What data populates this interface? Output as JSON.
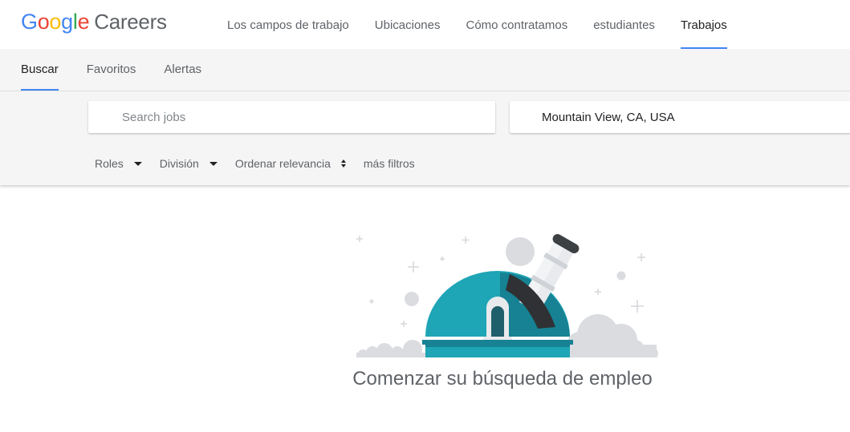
{
  "header": {
    "logo": {
      "google": "Google",
      "careers": "Careers"
    },
    "nav": [
      {
        "label": "Los campos de trabajo",
        "active": false
      },
      {
        "label": "Ubicaciones",
        "active": false
      },
      {
        "label": "Cómo contratamos",
        "active": false
      },
      {
        "label": "estudiantes",
        "active": false
      },
      {
        "label": "Trabajos",
        "active": true
      }
    ]
  },
  "tabs": [
    {
      "label": "Buscar",
      "active": true
    },
    {
      "label": "Favoritos",
      "active": false
    },
    {
      "label": "Alertas",
      "active": false
    }
  ],
  "search": {
    "jobs_placeholder": "Search jobs",
    "jobs_value": "",
    "location_value": "Mountain View, CA, USA"
  },
  "filters": {
    "roles": "Roles",
    "division": "División",
    "sort": "Ordenar relevancia",
    "more": "más filtros"
  },
  "empty_state": {
    "message": "Comenzar su búsqueda de empleo"
  },
  "colors": {
    "accent": "#4285f4",
    "dome": "#1ea5b6",
    "dome_dark": "#168293"
  }
}
